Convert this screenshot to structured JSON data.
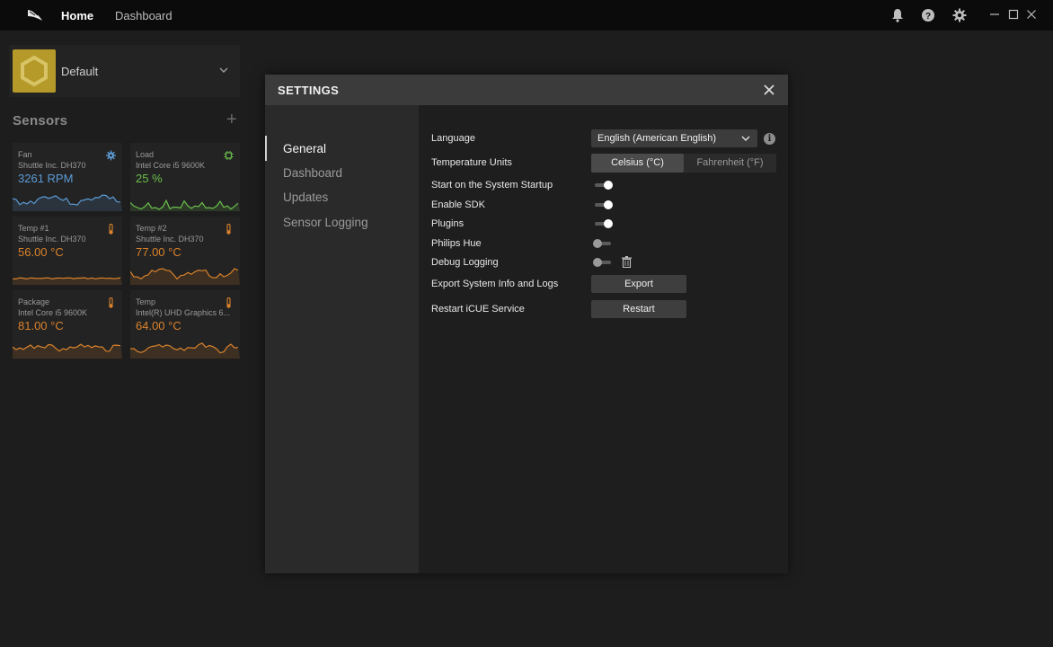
{
  "topbar": {
    "nav": [
      {
        "label": "Home"
      },
      {
        "label": "Dashboard"
      }
    ],
    "icons": [
      "bell-icon",
      "help-icon",
      "gear-icon",
      "minimize-icon",
      "maximize-icon",
      "close-icon"
    ]
  },
  "profile": {
    "name": "Default",
    "icon_color": "#b59a2a"
  },
  "sensors": {
    "title": "Sensors",
    "add_label": "+",
    "cards": [
      {
        "title": "Fan",
        "subtitle": "Shuttle Inc. DH370",
        "value": "3261",
        "unit": "RPM",
        "color": "#5b9bd5",
        "icon": "fan-settings-icon"
      },
      {
        "title": "Load",
        "subtitle": "Intel Core i5 9600K",
        "value": "25",
        "unit": "%",
        "color": "#6abf4b",
        "icon": "chip-icon"
      },
      {
        "title": "Temp #1",
        "subtitle": "Shuttle Inc. DH370",
        "value": "56.00",
        "unit": "°C",
        "color": "#d9822b",
        "icon": "thermometer-icon"
      },
      {
        "title": "Temp #2",
        "subtitle": "Shuttle Inc. DH370",
        "value": "77.00",
        "unit": "°C",
        "color": "#d9822b",
        "icon": "thermometer-icon"
      },
      {
        "title": "Package",
        "subtitle": "Intel Core i5 9600K",
        "value": "81.00",
        "unit": "°C",
        "color": "#d9822b",
        "icon": "thermometer-icon"
      },
      {
        "title": "Temp",
        "subtitle": "Intel(R) UHD Graphics 6...",
        "value": "64.00",
        "unit": "°C",
        "color": "#d9822b",
        "icon": "thermometer-icon"
      }
    ]
  },
  "settings": {
    "title": "SETTINGS",
    "side": [
      {
        "label": "General"
      },
      {
        "label": "Dashboard"
      },
      {
        "label": "Updates"
      },
      {
        "label": "Sensor Logging"
      }
    ],
    "active_side": "General",
    "language": {
      "label": "Language",
      "value": "English (American English)"
    },
    "temperature": {
      "label": "Temperature Units",
      "options": [
        "Celsius (°C)",
        "Fahrenheit (°F)"
      ],
      "selected": "Celsius (°C)"
    },
    "toggles": [
      {
        "label": "Start on the System Startup",
        "on": true
      },
      {
        "label": "Enable SDK",
        "on": true
      },
      {
        "label": "Plugins",
        "on": true
      },
      {
        "label": "Philips Hue",
        "on": false
      },
      {
        "label": "Debug Logging",
        "on": false
      }
    ],
    "export": {
      "label": "Export System Info and Logs",
      "button": "Export"
    },
    "restart": {
      "label": "Restart iCUE Service",
      "button": "Restart"
    }
  }
}
